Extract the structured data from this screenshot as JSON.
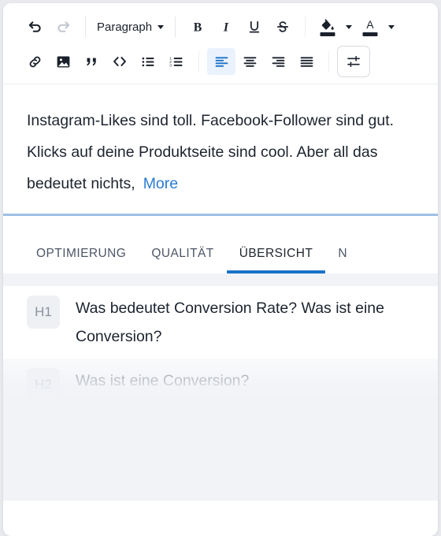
{
  "colors": {
    "accent_blue": "#1a73c8",
    "link_blue": "#2b7cd3",
    "divider_blue": "#9ec0e5",
    "active_tool_bg": "#eaf2fd",
    "panel_bg": "#f1f3f7",
    "badge_bg": "#eef0f4",
    "text_dark": "#1d232e",
    "text_muted": "#4d5666",
    "swatch_fill": "#1b212c",
    "swatch_text": "#1b212c"
  },
  "toolbar": {
    "row1": [
      {
        "name": "undo-icon",
        "label": "Undo",
        "state": "enabled"
      },
      {
        "name": "redo-icon",
        "label": "Redo",
        "state": "disabled"
      },
      {
        "name": "paragraph-style-select",
        "label": "Paragraph",
        "state": "enabled"
      },
      {
        "name": "bold-icon",
        "label": "Bold",
        "state": "enabled"
      },
      {
        "name": "italic-icon",
        "label": "Italic",
        "state": "enabled"
      },
      {
        "name": "underline-icon",
        "label": "Underline",
        "state": "enabled"
      },
      {
        "name": "strikethrough-icon",
        "label": "Strikethrough",
        "state": "enabled"
      },
      {
        "name": "fill-color-icon",
        "label": "Fill color",
        "state": "enabled"
      },
      {
        "name": "text-color-icon",
        "label": "Text color",
        "state": "enabled"
      }
    ],
    "row2": [
      {
        "name": "link-icon",
        "label": "Insert link",
        "state": "enabled"
      },
      {
        "name": "image-icon",
        "label": "Insert image",
        "state": "enabled"
      },
      {
        "name": "quote-icon",
        "label": "Blockquote",
        "state": "enabled"
      },
      {
        "name": "code-icon",
        "label": "Code",
        "state": "enabled"
      },
      {
        "name": "bullet-list-icon",
        "label": "Bulleted list",
        "state": "enabled"
      },
      {
        "name": "numbered-list-icon",
        "label": "Numbered list",
        "state": "enabled"
      },
      {
        "name": "align-left-icon",
        "label": "Align left",
        "state": "active"
      },
      {
        "name": "align-center-icon",
        "label": "Align center",
        "state": "enabled"
      },
      {
        "name": "align-right-icon",
        "label": "Align right",
        "state": "enabled"
      },
      {
        "name": "align-justify-icon",
        "label": "Justify",
        "state": "enabled"
      },
      {
        "name": "settings-tune-icon",
        "label": "Settings",
        "state": "enabled"
      }
    ],
    "paragraph_label": "Paragraph"
  },
  "editor": {
    "body_text": "Instagram-Likes sind toll. Facebook-Follower sind gut. Klicks auf deine Produktseite sind cool. Aber all das bedeutet nichts,",
    "more_link": "More"
  },
  "tabs": [
    {
      "label": "OPTIMIERUNG",
      "active": false
    },
    {
      "label": "QUALITÄT",
      "active": false
    },
    {
      "label": "ÜBERSICHT",
      "active": true
    },
    {
      "label": "N",
      "active": false
    }
  ],
  "outline": {
    "items": [
      {
        "level": "H1",
        "text": "Was bedeutet Conversion Rate? Was ist eine Conversion?",
        "faded": false
      },
      {
        "level": "H2",
        "text": "Was ist eine Conversion?",
        "faded": true
      }
    ]
  }
}
